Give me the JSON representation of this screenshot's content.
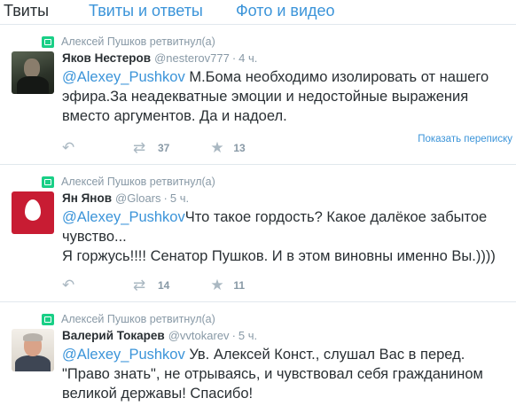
{
  "tabs": [
    "Твиты",
    "Твиты и ответы",
    "Фото и видео"
  ],
  "tweets": [
    {
      "retweeted_by": "Алексей Пушков ретвитнул(а)",
      "name": "Яков Нестеров",
      "handle": "@nesterov777",
      "time": "4 ч.",
      "mention": "@Alexey_Pushkov",
      "text": " М.Бома необходимо изолировать от нашего эфира.За неадекватные эмоции и недостойные выражения вместо аргументов. Да и надоел.",
      "retweets": "37",
      "favorites": "13",
      "conversation_link": "Показать переписку"
    },
    {
      "retweeted_by": "Алексей Пушков ретвитнул(а)",
      "name": "Ян Янов",
      "handle": "@Gloars",
      "time": "5 ч.",
      "mention": "@Alexey_Pushkov",
      "text": "Что такое гордость? Какое далёкое забытое чувство...",
      "text_line2": "Я горжусь!!!! Сенатор Пушков. И в этом виновны именно Вы.))))",
      "retweets": "14",
      "favorites": "11"
    },
    {
      "retweeted_by": "Алексей Пушков ретвитнул(а)",
      "name": "Валерий Токарев",
      "handle": "@vvtokarev",
      "time": "5 ч.",
      "mention": "@Alexey_Pushkov",
      "text": " Ув. Алексей Конст., слушал Вас в перед. \"Право знать\", не отрываясь, и чувствовал себя гражданином великой державы! Спасибо!"
    }
  ],
  "dot": "·",
  "icons": {
    "retweet_badge": "retweet-icon",
    "reply": "reply-icon",
    "retweet": "retweet-icon",
    "favorite": "star-icon"
  },
  "colors": {
    "link": "#3b94d9",
    "retweet_green": "#19cf86",
    "meta_gray": "#8899a6"
  }
}
